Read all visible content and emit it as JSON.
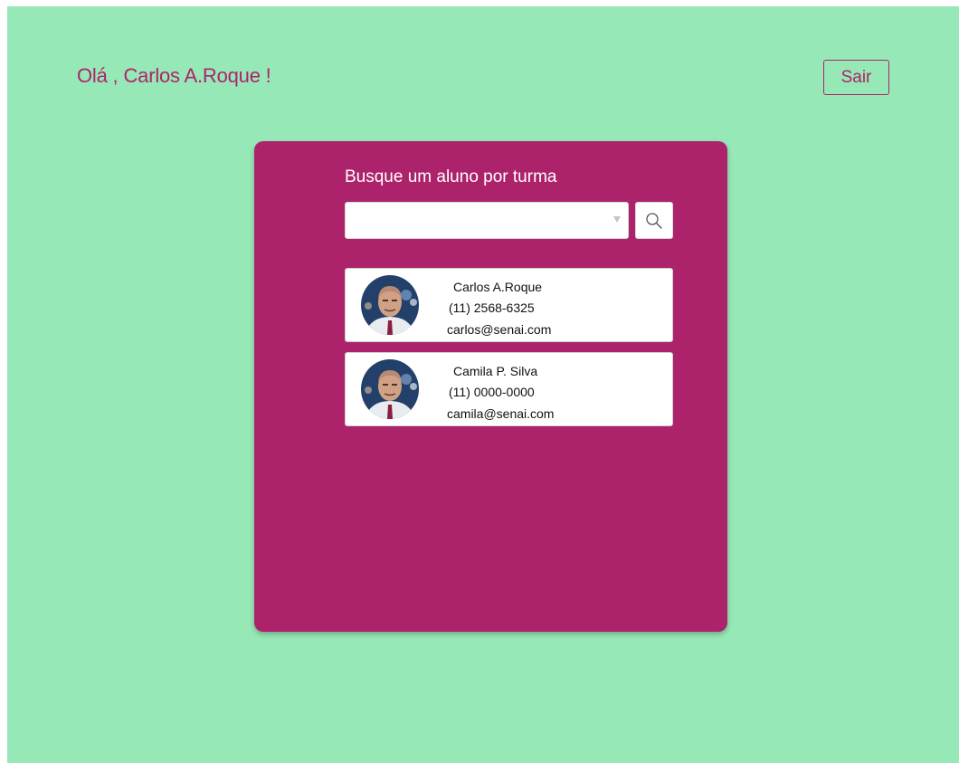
{
  "header": {
    "greeting_prefix": "Olá ,",
    "user_name": "Carlos A.Roque !",
    "logout_label": "Sair"
  },
  "search": {
    "title": "Busque um aluno por turma",
    "selected_class": "",
    "search_icon": "search-icon"
  },
  "students": [
    {
      "name": "Carlos A.Roque",
      "phone": "(11) 2568-6325",
      "email": "carlos@senai.com"
    },
    {
      "name": "Camila P. Silva",
      "phone": "(11) 0000-0000",
      "email": "camila@senai.com"
    }
  ],
  "colors": {
    "background": "#97e8b7",
    "accent": "#ad236b",
    "card_text": "#ffffff"
  }
}
